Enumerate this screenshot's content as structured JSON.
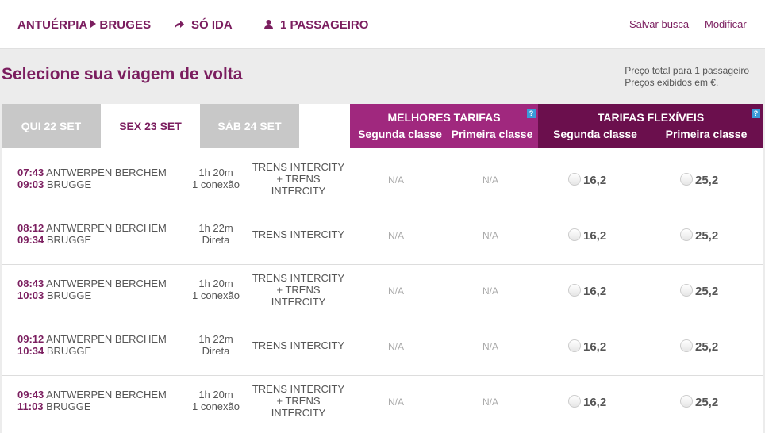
{
  "header": {
    "origin": "ANTUÉRPIA",
    "destination": "BRUGES",
    "trip_type": "SÓ IDA",
    "passengers": "1 PASSAGEIRO",
    "save_search": "Salvar busca",
    "modify": "Modificar"
  },
  "page": {
    "title": "Selecione sua viagem de volta",
    "price_note_1": "Preço total para 1 passageiro",
    "price_note_2": "Preços exibidos em €."
  },
  "date_tabs": [
    {
      "label": "QUI 22 SET"
    },
    {
      "label": "SEX 23 SET"
    },
    {
      "label": "SÁB 24 SET"
    }
  ],
  "fare_groups": {
    "best": {
      "title": "MELHORES TARIFAS",
      "second": "Segunda classe",
      "first": "Primeira classe",
      "help": "?"
    },
    "flex": {
      "title": "TARIFAS FLEXÍVEIS",
      "second": "Segunda classe",
      "first": "Primeira classe",
      "help": "?"
    }
  },
  "rows": [
    {
      "dep_time": "07:43",
      "dep_station": "ANTWERPEN BERCHEM",
      "arr_time": "09:03",
      "arr_station": "BRUGGE",
      "duration": "1h 20m",
      "connections": "1 conexão",
      "train_1": "TRENS INTERCITY",
      "train_2": "+ TRENS",
      "train_3": "INTERCITY",
      "best_second": "N/A",
      "best_first": "N/A",
      "flex_second": "16,2",
      "flex_first": "25,2"
    },
    {
      "dep_time": "08:12",
      "dep_station": "ANTWERPEN BERCHEM",
      "arr_time": "09:34",
      "arr_station": "BRUGGE",
      "duration": "1h 22m",
      "connections": "Direta",
      "train_1": "TRENS INTERCITY",
      "train_2": "",
      "train_3": "",
      "best_second": "N/A",
      "best_first": "N/A",
      "flex_second": "16,2",
      "flex_first": "25,2"
    },
    {
      "dep_time": "08:43",
      "dep_station": "ANTWERPEN BERCHEM",
      "arr_time": "10:03",
      "arr_station": "BRUGGE",
      "duration": "1h 20m",
      "connections": "1 conexão",
      "train_1": "TRENS INTERCITY",
      "train_2": "+ TRENS",
      "train_3": "INTERCITY",
      "best_second": "N/A",
      "best_first": "N/A",
      "flex_second": "16,2",
      "flex_first": "25,2"
    },
    {
      "dep_time": "09:12",
      "dep_station": "ANTWERPEN BERCHEM",
      "arr_time": "10:34",
      "arr_station": "BRUGGE",
      "duration": "1h 22m",
      "connections": "Direta",
      "train_1": "TRENS INTERCITY",
      "train_2": "",
      "train_3": "",
      "best_second": "N/A",
      "best_first": "N/A",
      "flex_second": "16,2",
      "flex_first": "25,2"
    },
    {
      "dep_time": "09:43",
      "dep_station": "ANTWERPEN BERCHEM",
      "arr_time": "11:03",
      "arr_station": "BRUGGE",
      "duration": "1h 20m",
      "connections": "1 conexão",
      "train_1": "TRENS INTERCITY",
      "train_2": "+ TRENS",
      "train_3": "INTERCITY",
      "best_second": "N/A",
      "best_first": "N/A",
      "flex_second": "16,2",
      "flex_first": "25,2"
    }
  ],
  "colors": {
    "brand": "#7b1e5f",
    "best_fares_bg": "#a0287e",
    "flex_fares_bg": "#6b0f4d",
    "tab_inactive": "#c8c8c8"
  }
}
